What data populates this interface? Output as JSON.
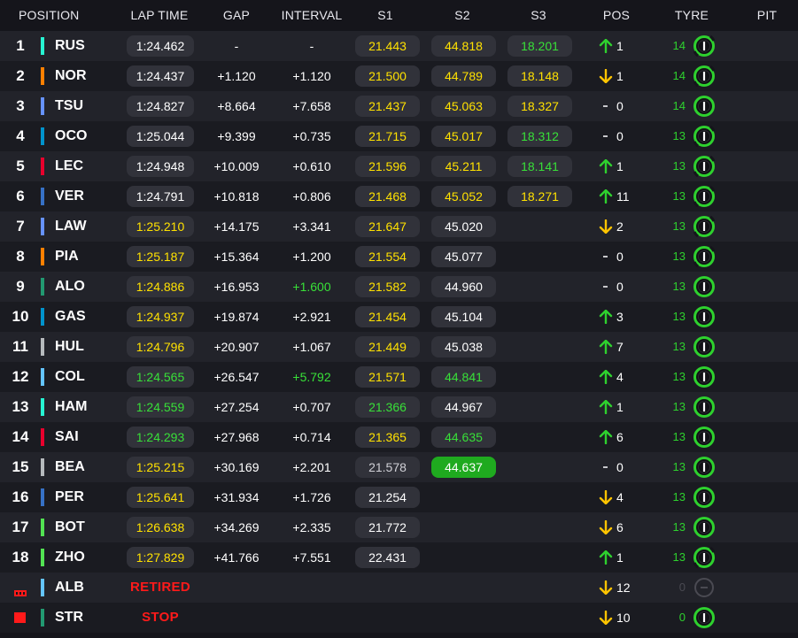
{
  "columns": [
    "POSITION",
    "LAP TIME",
    "GAP",
    "INTERVAL",
    "S1",
    "S2",
    "S3",
    "POS",
    "TYRE",
    "PIT"
  ],
  "colors": {
    "yellow": "#ffe100",
    "green": "#38e038",
    "white": "#ffffff",
    "grey_text": "#d0d0d6",
    "pill_bg": "#31323a",
    "fastest_bg": "#1faa1f",
    "arrow_up": "#2ed12e",
    "arrow_down": "#ffc400",
    "retired_red": "#ff1a1a"
  },
  "rows": [
    {
      "position": "1",
      "team_color": "#27f4d2",
      "driver": "RUS",
      "lap": "1:24.462",
      "lap_color": "white",
      "gap": "-",
      "interval": "-",
      "interval_color": "white",
      "s1": "21.443",
      "s1_color": "yellow",
      "s2": "44.818",
      "s2_color": "yellow",
      "s3": "18.201",
      "s3_color": "green",
      "pos_dir": "up",
      "pos_change": "1",
      "tyre_age": "14",
      "tyre_icon": "tyre-intermediate-partial-icon"
    },
    {
      "position": "2",
      "team_color": "#ff8000",
      "driver": "NOR",
      "lap": "1:24.437",
      "lap_color": "white",
      "gap": "+1.120",
      "interval": "+1.120",
      "interval_color": "white",
      "s1": "21.500",
      "s1_color": "yellow",
      "s2": "44.789",
      "s2_color": "yellow",
      "s3": "18.148",
      "s3_color": "yellow",
      "pos_dir": "down",
      "pos_change": "1",
      "tyre_age": "14",
      "tyre_icon": "tyre-intermediate-partial-icon"
    },
    {
      "position": "3",
      "team_color": "#6692ff",
      "driver": "TSU",
      "lap": "1:24.827",
      "lap_color": "white",
      "gap": "+8.664",
      "interval": "+7.658",
      "interval_color": "white",
      "s1": "21.437",
      "s1_color": "yellow",
      "s2": "45.063",
      "s2_color": "yellow",
      "s3": "18.327",
      "s3_color": "yellow",
      "pos_dir": "none",
      "pos_change": "0",
      "tyre_age": "14",
      "tyre_icon": "tyre-intermediate-icon"
    },
    {
      "position": "4",
      "team_color": "#0093cc",
      "driver": "OCO",
      "lap": "1:25.044",
      "lap_color": "white",
      "gap": "+9.399",
      "interval": "+0.735",
      "interval_color": "white",
      "s1": "21.715",
      "s1_color": "yellow",
      "s2": "45.017",
      "s2_color": "yellow",
      "s3": "18.312",
      "s3_color": "green",
      "pos_dir": "none",
      "pos_change": "0",
      "tyre_age": "13",
      "tyre_icon": "tyre-intermediate-partial-icon"
    },
    {
      "position": "5",
      "team_color": "#e8002d",
      "driver": "LEC",
      "lap": "1:24.948",
      "lap_color": "white",
      "gap": "+10.009",
      "interval": "+0.610",
      "interval_color": "white",
      "s1": "21.596",
      "s1_color": "yellow",
      "s2": "45.211",
      "s2_color": "yellow",
      "s3": "18.141",
      "s3_color": "green",
      "pos_dir": "up",
      "pos_change": "1",
      "tyre_age": "13",
      "tyre_icon": "tyre-intermediate-partial-icon"
    },
    {
      "position": "6",
      "team_color": "#3671c6",
      "driver": "VER",
      "lap": "1:24.791",
      "lap_color": "white",
      "gap": "+10.818",
      "interval": "+0.806",
      "interval_color": "white",
      "s1": "21.468",
      "s1_color": "yellow",
      "s2": "45.052",
      "s2_color": "yellow",
      "s3": "18.271",
      "s3_color": "yellow",
      "pos_dir": "up",
      "pos_change": "11",
      "tyre_age": "13",
      "tyre_icon": "tyre-intermediate-partial-icon"
    },
    {
      "position": "7",
      "team_color": "#6692ff",
      "driver": "LAW",
      "lap": "1:25.210",
      "lap_color": "yellow",
      "gap": "+14.175",
      "interval": "+3.341",
      "interval_color": "white",
      "s1": "21.647",
      "s1_color": "yellow",
      "s2": "45.020",
      "s2_color": "white",
      "s3": "",
      "s3_color": "none",
      "pos_dir": "down",
      "pos_change": "2",
      "tyre_age": "13",
      "tyre_icon": "tyre-intermediate-partial-icon"
    },
    {
      "position": "8",
      "team_color": "#ff8000",
      "driver": "PIA",
      "lap": "1:25.187",
      "lap_color": "yellow",
      "gap": "+15.364",
      "interval": "+1.200",
      "interval_color": "white",
      "s1": "21.554",
      "s1_color": "yellow",
      "s2": "45.077",
      "s2_color": "white",
      "s3": "",
      "s3_color": "none",
      "pos_dir": "none",
      "pos_change": "0",
      "tyre_age": "13",
      "tyre_icon": "tyre-intermediate-partial-icon"
    },
    {
      "position": "9",
      "team_color": "#229971",
      "driver": "ALO",
      "lap": "1:24.886",
      "lap_color": "yellow",
      "gap": "+16.953",
      "interval": "+1.600",
      "interval_color": "green",
      "s1": "21.582",
      "s1_color": "yellow",
      "s2": "44.960",
      "s2_color": "white",
      "s3": "",
      "s3_color": "none",
      "pos_dir": "none",
      "pos_change": "0",
      "tyre_age": "13",
      "tyre_icon": "tyre-intermediate-icon"
    },
    {
      "position": "10",
      "team_color": "#0093cc",
      "driver": "GAS",
      "lap": "1:24.937",
      "lap_color": "yellow",
      "gap": "+19.874",
      "interval": "+2.921",
      "interval_color": "white",
      "s1": "21.454",
      "s1_color": "yellow",
      "s2": "45.104",
      "s2_color": "white",
      "s3": "",
      "s3_color": "none",
      "pos_dir": "up",
      "pos_change": "3",
      "tyre_age": "13",
      "tyre_icon": "tyre-intermediate-icon"
    },
    {
      "position": "11",
      "team_color": "#b6babd",
      "driver": "HUL",
      "lap": "1:24.796",
      "lap_color": "yellow",
      "gap": "+20.907",
      "interval": "+1.067",
      "interval_color": "white",
      "s1": "21.449",
      "s1_color": "yellow",
      "s2": "45.038",
      "s2_color": "white",
      "s3": "",
      "s3_color": "none",
      "pos_dir": "up",
      "pos_change": "7",
      "tyre_age": "13",
      "tyre_icon": "tyre-intermediate-icon"
    },
    {
      "position": "12",
      "team_color": "#64c4ff",
      "driver": "COL",
      "lap": "1:24.565",
      "lap_color": "green",
      "gap": "+26.547",
      "interval": "+5.792",
      "interval_color": "green",
      "s1": "21.571",
      "s1_color": "yellow",
      "s2": "44.841",
      "s2_color": "green",
      "s3": "",
      "s3_color": "none",
      "pos_dir": "up",
      "pos_change": "4",
      "tyre_age": "13",
      "tyre_icon": "tyre-intermediate-icon"
    },
    {
      "position": "13",
      "team_color": "#27f4d2",
      "driver": "HAM",
      "lap": "1:24.559",
      "lap_color": "green",
      "gap": "+27.254",
      "interval": "+0.707",
      "interval_color": "white",
      "s1": "21.366",
      "s1_color": "green",
      "s2": "44.967",
      "s2_color": "white",
      "s3": "",
      "s3_color": "none",
      "pos_dir": "up",
      "pos_change": "1",
      "tyre_age": "13",
      "tyre_icon": "tyre-intermediate-icon"
    },
    {
      "position": "14",
      "team_color": "#e8002d",
      "driver": "SAI",
      "lap": "1:24.293",
      "lap_color": "green",
      "gap": "+27.968",
      "interval": "+0.714",
      "interval_color": "white",
      "s1": "21.365",
      "s1_color": "yellow",
      "s2": "44.635",
      "s2_color": "green",
      "s3": "",
      "s3_color": "none",
      "pos_dir": "up",
      "pos_change": "6",
      "tyre_age": "13",
      "tyre_icon": "tyre-intermediate-icon"
    },
    {
      "position": "15",
      "team_color": "#b6babd",
      "driver": "BEA",
      "lap": "1:25.215",
      "lap_color": "yellow",
      "gap": "+30.169",
      "interval": "+2.201",
      "interval_color": "white",
      "s1": "21.578",
      "s1_color": "grey",
      "s2": "44.637",
      "s2_color": "fastest",
      "s3": "",
      "s3_color": "none",
      "pos_dir": "none",
      "pos_change": "0",
      "tyre_age": "13",
      "tyre_icon": "tyre-intermediate-icon"
    },
    {
      "position": "16",
      "team_color": "#3671c6",
      "driver": "PER",
      "lap": "1:25.641",
      "lap_color": "yellow",
      "gap": "+31.934",
      "interval": "+1.726",
      "interval_color": "white",
      "s1": "21.254",
      "s1_color": "white",
      "s2": "",
      "s2_color": "none",
      "s3": "",
      "s3_color": "none",
      "pos_dir": "down",
      "pos_change": "4",
      "tyre_age": "13",
      "tyre_icon": "tyre-intermediate-icon"
    },
    {
      "position": "17",
      "team_color": "#52e252",
      "driver": "BOT",
      "lap": "1:26.638",
      "lap_color": "yellow",
      "gap": "+34.269",
      "interval": "+2.335",
      "interval_color": "white",
      "s1": "21.772",
      "s1_color": "white",
      "s2": "",
      "s2_color": "none",
      "s3": "",
      "s3_color": "none",
      "pos_dir": "down",
      "pos_change": "6",
      "tyre_age": "13",
      "tyre_icon": "tyre-intermediate-icon"
    },
    {
      "position": "18",
      "team_color": "#52e252",
      "driver": "ZHO",
      "lap": "1:27.829",
      "lap_color": "yellow",
      "gap": "+41.766",
      "interval": "+7.551",
      "interval_color": "white",
      "s1": "22.431",
      "s1_color": "white",
      "s2": "",
      "s2_color": "none",
      "s3": "",
      "s3_color": "none",
      "pos_dir": "up",
      "pos_change": "1",
      "tyre_age": "13",
      "tyre_icon": "tyre-intermediate-partial-icon"
    },
    {
      "position": "",
      "status_icon": "retired-flag-icon",
      "team_color": "#64c4ff",
      "driver": "ALB",
      "status": "RETIRED",
      "pos_dir": "down",
      "pos_change": "12",
      "tyre_age": "0",
      "tyre_icon": "tyre-unknown-icon"
    },
    {
      "position": "",
      "status_icon": "stop-square-icon",
      "team_color": "#229971",
      "driver": "STR",
      "status": "STOP",
      "pos_dir": "down",
      "pos_change": "10",
      "tyre_age": "0",
      "tyre_icon": "tyre-intermediate-icon"
    }
  ]
}
